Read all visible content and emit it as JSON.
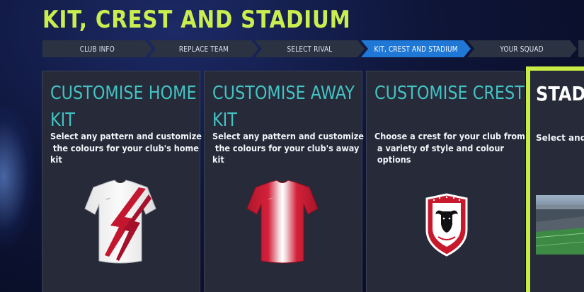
{
  "page": {
    "title": "KIT, CREST AND STADIUM"
  },
  "steps": [
    {
      "label": "CLUB INFO",
      "active": false
    },
    {
      "label": "REPLACE TEAM",
      "active": false
    },
    {
      "label": "SELECT RIVAL",
      "active": false
    },
    {
      "label": "KIT, CREST AND STADIUM",
      "active": true
    },
    {
      "label": "YOUR SQUAD",
      "active": false
    }
  ],
  "cards": {
    "home_kit": {
      "title_line1": "CUSTOMISE HOME",
      "title_line2": "KIT",
      "desc_line1": "Select any pattern and customize",
      "desc_line2": " the colours for your club's home",
      "desc_line3": "kit"
    },
    "away_kit": {
      "title_line1": "CUSTOMISE AWAY",
      "title_line2": "KIT",
      "desc_line1": "Select any pattern and customize",
      "desc_line2": " the colours for your club's away",
      "desc_line3": "kit"
    },
    "crest": {
      "title_line1": "CUSTOMISE CREST",
      "desc_line1": "Choose a crest for your club from",
      "desc_line2": " a variety of style and colour",
      "desc_line3": " options"
    },
    "stadium": {
      "title": "STADIU",
      "desc": "Select and c"
    }
  },
  "colors": {
    "title_accent": "#c9ee4e",
    "card_title": "#43c3c3",
    "active_step": "#1f78d6",
    "stadium_highlight": "#c6ec45"
  },
  "icons": {
    "home_kit": "white-shirt-red-lightning",
    "away_kit": "red-shirt-white-stripes",
    "crest": "buffalo-shield-crest"
  }
}
